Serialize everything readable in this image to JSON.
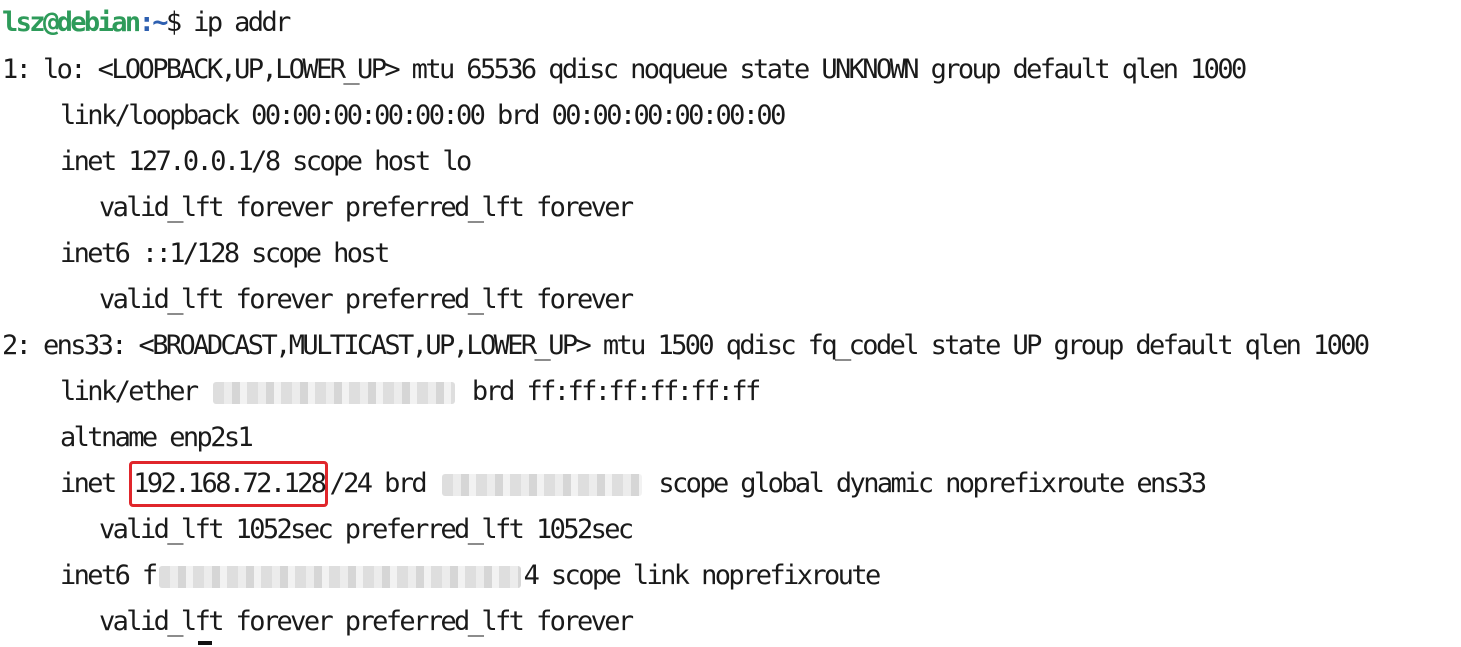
{
  "terminal": {
    "prompt": {
      "user_host": "lsz@debian",
      "path": ":~",
      "symbol": "$",
      "command": " ip addr"
    },
    "lo": {
      "header": "1: lo: <LOOPBACK,UP,LOWER_UP> mtu 65536 qdisc noqueue state UNKNOWN group default qlen 1000",
      "link": "link/loopback 00:00:00:00:00:00 brd 00:00:00:00:00:00",
      "inet": "inet 127.0.0.1/8 scope host lo",
      "inet_lft": "valid_lft forever preferred_lft forever",
      "inet6": "inet6 ::1/128 scope host",
      "inet6_lft": "valid_lft forever preferred_lft forever"
    },
    "ens33": {
      "header": "2: ens33: <BROADCAST,MULTICAST,UP,LOWER_UP> mtu 1500 qdisc fq_codel state UP group default qlen 1000",
      "link_prefix": "link/ether",
      "link_suffix": "brd ff:ff:ff:ff:ff:ff",
      "altname": "altname enp2s1",
      "inet_prefix": "inet",
      "inet_address": "192.168.72.128",
      "inet_mask_brd": "/24 brd",
      "inet_suffix": "scope global dynamic noprefixroute ens33",
      "inet_lft": "valid_lft 1052sec preferred_lft 1052sec",
      "inet6_prefix": "inet6 f",
      "inet6_suffix": "4 scope link noprefixroute",
      "inet6_lft": "valid_lft forever preferred_lft forever"
    },
    "colors": {
      "user_host": "#2e9b5a",
      "path": "#2d5fb0",
      "highlight_border": "#e0262b",
      "text": "#1a1a1a",
      "background": "#ffffff"
    }
  }
}
